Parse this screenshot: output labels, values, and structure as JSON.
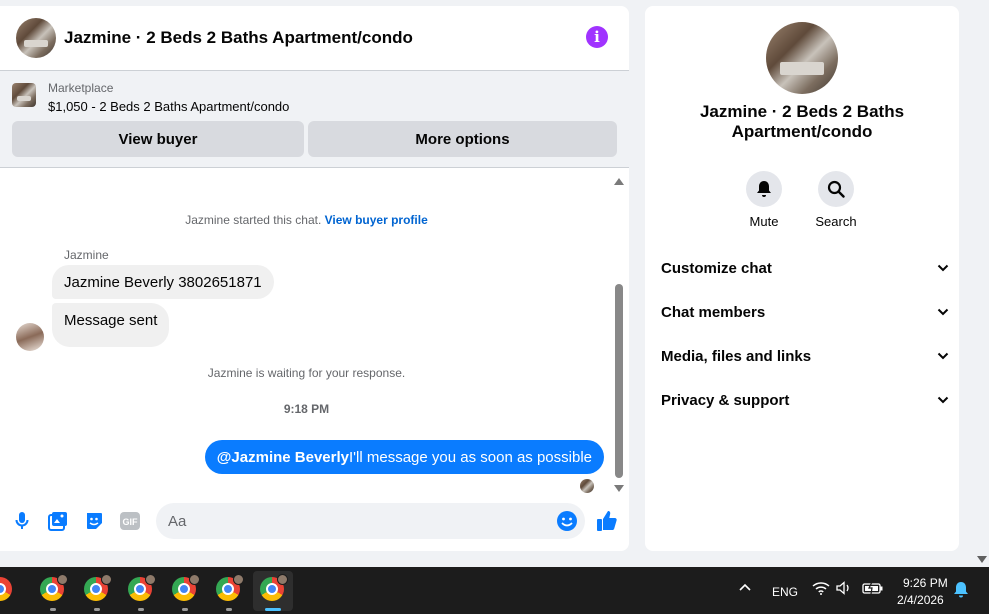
{
  "chat": {
    "title": "Jazmine · 2 Beds 2 Baths Apartment/condo",
    "info_icon": "info-icon",
    "marketplace_label": "Marketplace",
    "listing": "$1,050 - 2 Beds 2 Baths Apartment/condo",
    "view_buyer_label": "View buyer",
    "more_options_label": "More options"
  },
  "messages": {
    "started_text": "Jazmine started this chat.",
    "view_profile_link": "View buyer profile",
    "sender_name": "Jazmine",
    "incoming": [
      "Jazmine Beverly 3802651871",
      "Message sent"
    ],
    "waiting_text": "Jazmine is waiting for your response.",
    "timestamp": "9:18 PM",
    "outgoing_mention": "@Jazmine Beverly",
    "outgoing_text": "I'll message you as soon as possible"
  },
  "composer": {
    "placeholder": "Aa",
    "icons": [
      "microphone-icon",
      "photo-icon",
      "sticker-icon",
      "gif-icon",
      "emoji-icon",
      "thumbs-up-icon"
    ],
    "gif_label": "GIF"
  },
  "details": {
    "title": "Jazmine · 2 Beds 2 Baths Apartment/condo",
    "actions": [
      {
        "label": "Mute",
        "icon": "bell-icon"
      },
      {
        "label": "Search",
        "icon": "search-icon"
      }
    ],
    "sections": [
      "Customize chat",
      "Chat members",
      "Media, files and links",
      "Privacy & support"
    ]
  },
  "taskbar": {
    "language": "ENG",
    "time": "9:26 PM",
    "date": "2/4/2026"
  },
  "colors": {
    "accent": "#0a7cff",
    "info": "#a033ff",
    "link": "#0064d1"
  }
}
